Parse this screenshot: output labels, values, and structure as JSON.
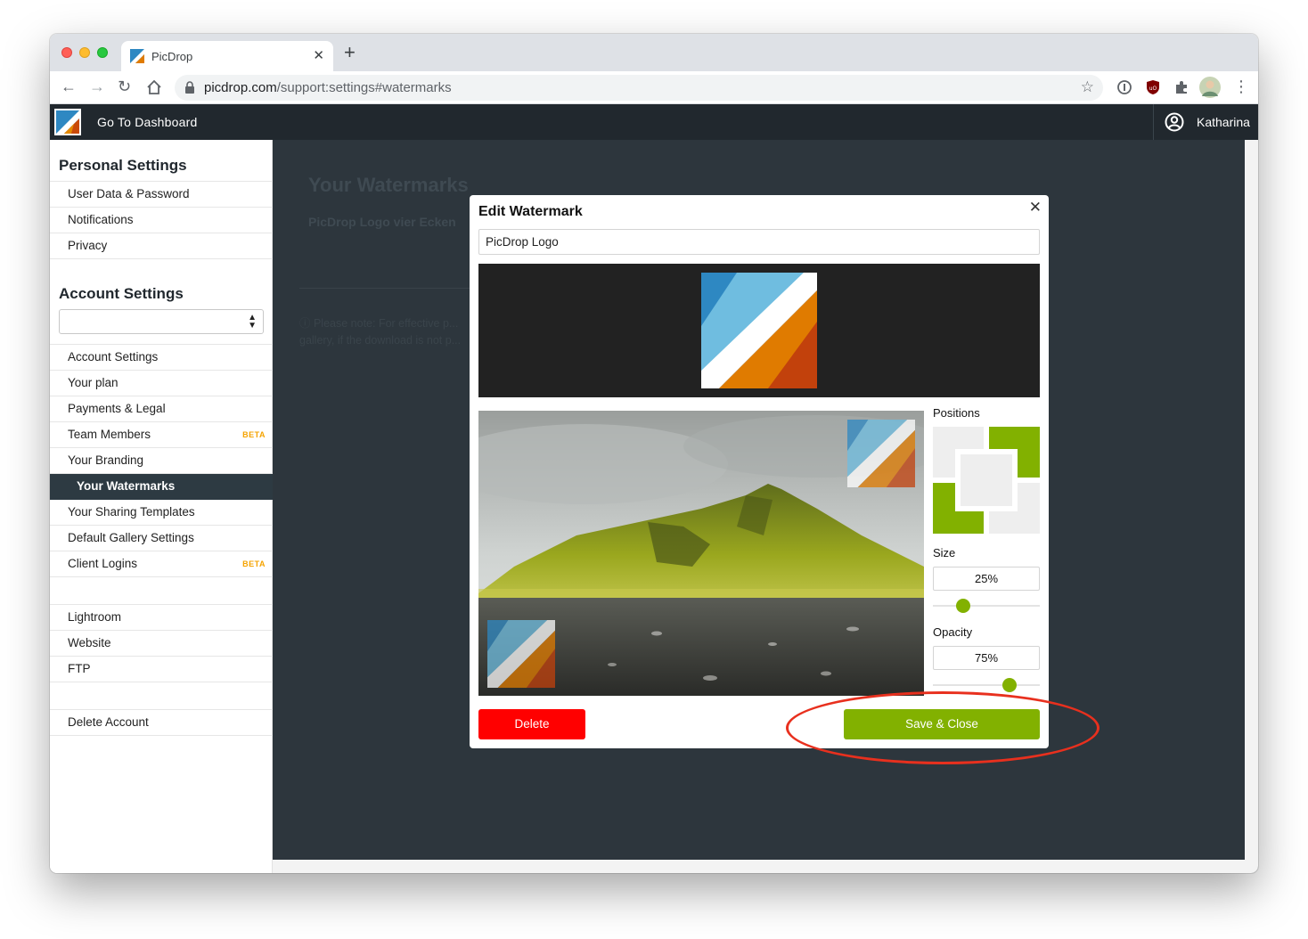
{
  "browser": {
    "tab_title": "PicDrop",
    "tab_close": "✕",
    "new_tab": "+",
    "url_host": "picdrop.com",
    "url_path": "/support:settings#watermarks",
    "icons": [
      "back-icon",
      "forward-icon",
      "reload-icon",
      "home-icon",
      "lock-icon",
      "star-icon",
      "extension-icons",
      "menu-icon"
    ]
  },
  "appbar": {
    "dashboard_link": "Go To Dashboard",
    "user_name": "Katharina"
  },
  "sidebar": {
    "personal_heading": "Personal Settings",
    "personal_items": [
      "User Data & Password",
      "Notifications",
      "Privacy"
    ],
    "account_heading": "Account Settings",
    "account_select_value": "",
    "account_items": [
      {
        "label": "Account Settings",
        "badge": ""
      },
      {
        "label": "Your plan",
        "badge": ""
      },
      {
        "label": "Payments & Legal",
        "badge": ""
      },
      {
        "label": "Team Members",
        "badge": "BETA"
      },
      {
        "label": "Your Branding",
        "badge": ""
      },
      {
        "label": "Your Watermarks",
        "badge": "",
        "active": true
      },
      {
        "label": "Your Sharing Templates",
        "badge": ""
      },
      {
        "label": "Default Gallery Settings",
        "badge": ""
      },
      {
        "label": "Client Logins",
        "badge": "BETA"
      }
    ],
    "integration_items": [
      "Lightroom",
      "Website",
      "FTP"
    ],
    "danger_items": [
      "Delete Account"
    ]
  },
  "background": {
    "title": "Your Watermarks",
    "watermark_name": "PicDrop Logo vier Ecken",
    "note": "ⓘ Please note: For effective p... gallery, if the download is not p..."
  },
  "modal": {
    "title": "Edit Watermark",
    "close": "✕",
    "name_value": "PicDrop Logo",
    "positions_label": "Positions",
    "positions_selected": [
      "top-right",
      "bottom-left"
    ],
    "size_label": "Size",
    "size_value": "25%",
    "size_fraction": 0.25,
    "opacity_label": "Opacity",
    "opacity_value": "75%",
    "opacity_fraction": 0.75,
    "delete_label": "Delete",
    "save_label": "Save & Close"
  },
  "colors": {
    "accent_green": "#82b100",
    "danger_red": "#ff0000",
    "header_dark": "#21282e",
    "annotation_red": "#e8301e"
  }
}
